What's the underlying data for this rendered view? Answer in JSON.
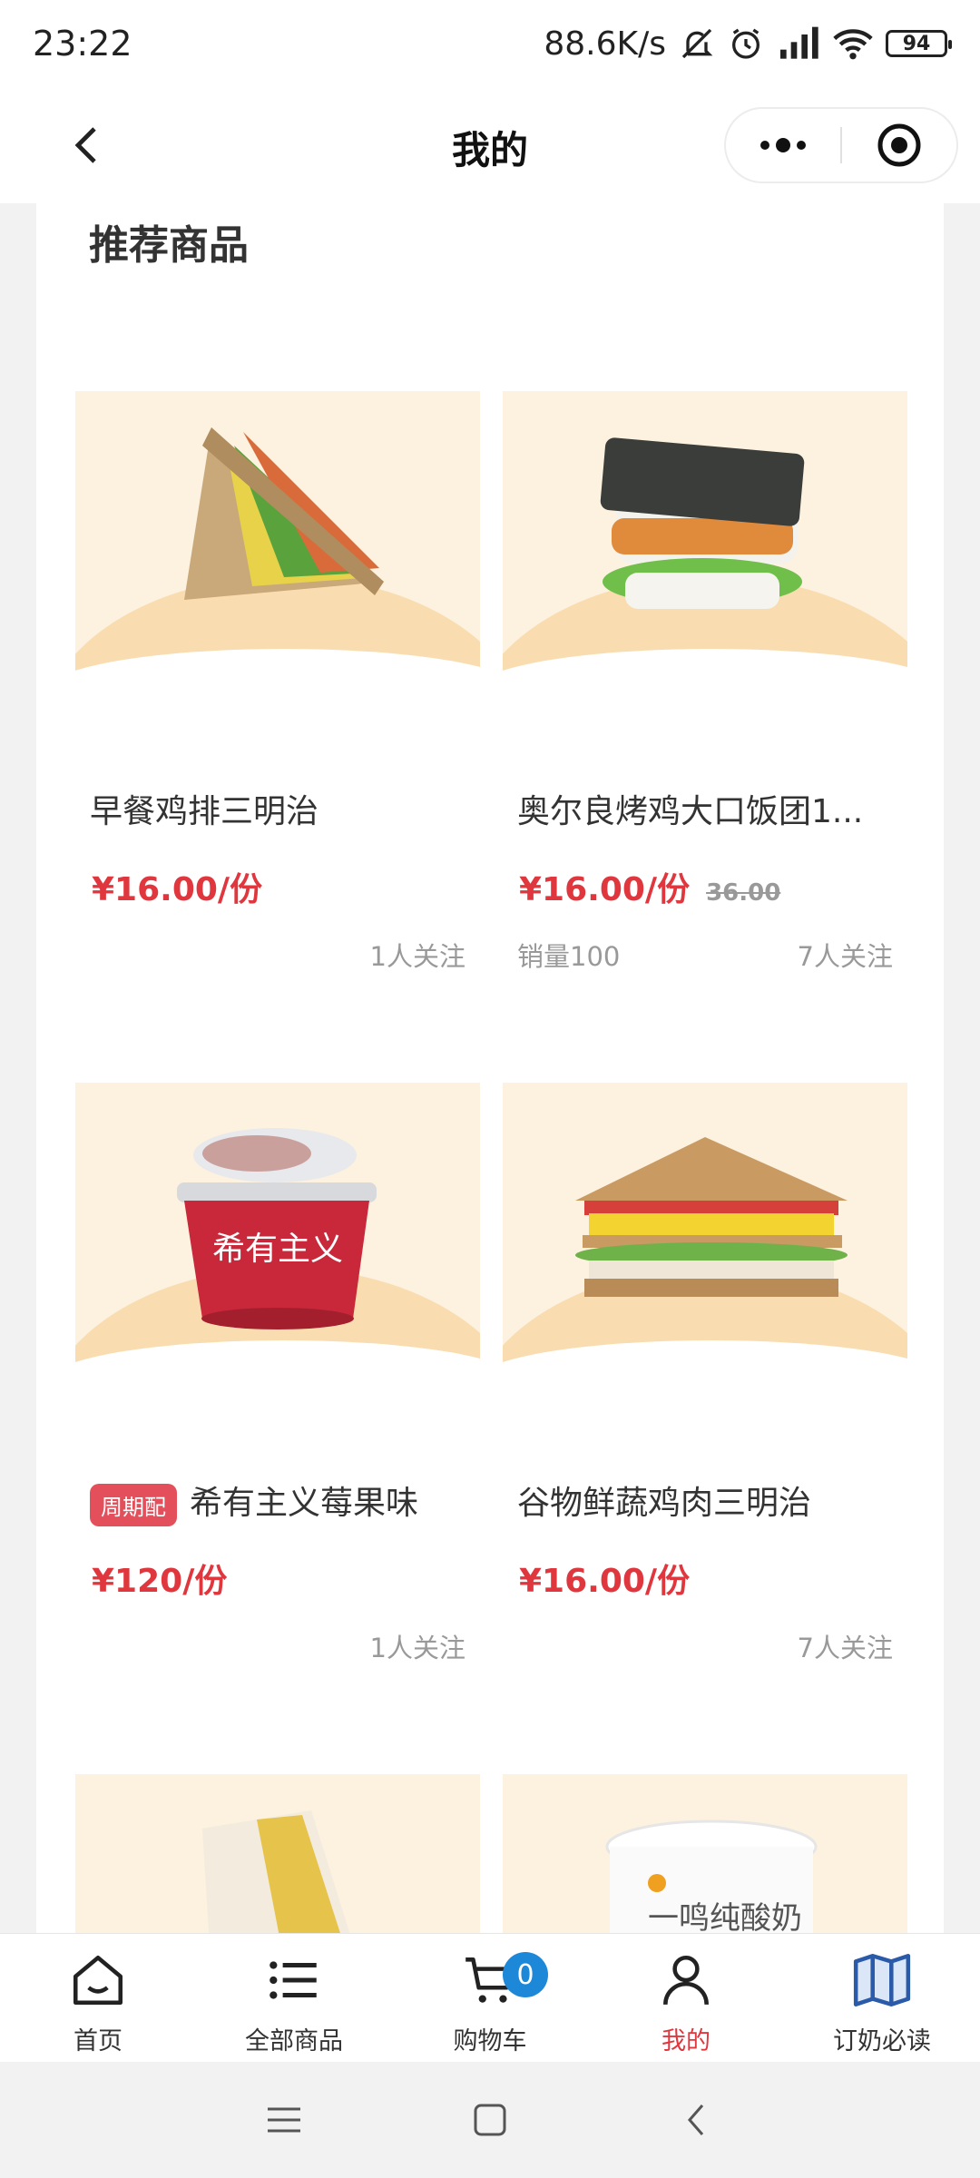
{
  "status_bar": {
    "time": "23:22",
    "net_speed": "88.6K/s",
    "battery": "94"
  },
  "header": {
    "title": "我的"
  },
  "section": {
    "title": "推荐商品"
  },
  "products": [
    {
      "name": "早餐鸡排三明治",
      "price": "¥16.00/份",
      "followers": "1人关注"
    },
    {
      "name": "奥尔良烤鸡大口饭团1...",
      "price": "¥16.00/份",
      "original_price": "36.00",
      "sales": "销量100",
      "followers": "7人关注"
    },
    {
      "tag": "周期配",
      "name": "希有主义莓果味",
      "price": "¥120/份",
      "followers": "1人关注",
      "packaging_text": "希有主义"
    },
    {
      "name": "谷物鲜蔬鸡肉三明治",
      "price": "¥16.00/份",
      "followers": "7人关注"
    },
    {
      "name": ""
    },
    {
      "name": "",
      "packaging_text": "一鸣纯酸奶"
    }
  ],
  "tab_bar": {
    "items": [
      {
        "label": "首页",
        "icon": "home-icon"
      },
      {
        "label": "全部商品",
        "icon": "list-icon"
      },
      {
        "label": "购物车",
        "icon": "cart-icon",
        "badge": "0"
      },
      {
        "label": "我的",
        "icon": "user-icon",
        "active": true
      },
      {
        "label": "订奶必读",
        "icon": "book-icon"
      }
    ]
  },
  "colors": {
    "price": "#e0373e",
    "tag": "#e3505b",
    "badge": "#1e88d8",
    "image_bg": "#fdf1df"
  }
}
